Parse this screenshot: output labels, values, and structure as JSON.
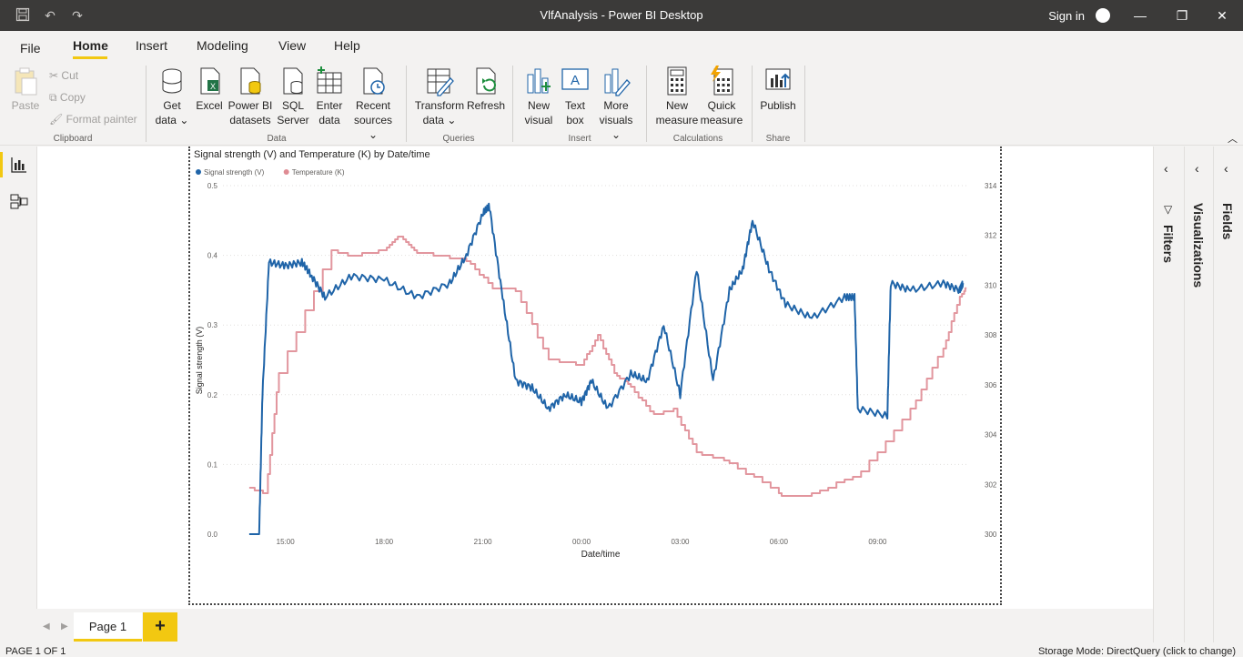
{
  "window": {
    "title": "VlfAnalysis - Power BI Desktop",
    "sign_in": "Sign in",
    "save_icon": "save-icon",
    "undo_icon": "undo-icon",
    "redo_icon": "redo-icon"
  },
  "menu": {
    "items": [
      "File",
      "Home",
      "Insert",
      "Modeling",
      "View",
      "Help"
    ],
    "active": "Home"
  },
  "ribbon": {
    "clipboard": {
      "paste": "Paste",
      "cut": "Cut",
      "copy": "Copy",
      "format_painter": "Format painter",
      "group": "Clipboard"
    },
    "data": {
      "get_data": [
        "Get",
        "data ⌄"
      ],
      "excel": "Excel",
      "power_bi_datasets": [
        "Power BI",
        "datasets"
      ],
      "sql_server": [
        "SQL",
        "Server"
      ],
      "enter_data": [
        "Enter",
        "data"
      ],
      "recent_sources": [
        "Recent",
        "sources ⌄"
      ],
      "group": "Data"
    },
    "queries": {
      "transform_data": [
        "Transform",
        "data ⌄"
      ],
      "refresh": "Refresh",
      "group": "Queries"
    },
    "insert": {
      "new_visual": [
        "New",
        "visual"
      ],
      "text_box": [
        "Text",
        "box"
      ],
      "more_visuals": [
        "More",
        "visuals ⌄"
      ],
      "group": "Insert"
    },
    "calculations": {
      "new_measure": [
        "New",
        "measure"
      ],
      "quick_measure": [
        "Quick",
        "measure"
      ],
      "group": "Calculations"
    },
    "share": {
      "publish": "Publish",
      "group": "Share"
    }
  },
  "panes": {
    "filters": "Filters",
    "visualizations": "Visualizations",
    "fields": "Fields"
  },
  "pages": {
    "tabs": [
      "Page 1"
    ],
    "add": "+"
  },
  "status": {
    "page": "PAGE 1 OF 1",
    "storage": "Storage Mode: DirectQuery (click to change)"
  },
  "chart_data": {
    "type": "line",
    "title": "Signal strength (V) and Temperature (K) by Date/time",
    "xlabel": "Date/time",
    "ylabel": "Signal strength (V)",
    "x_ticks": [
      "15:00",
      "18:00",
      "21:00",
      "00:00",
      "03:00",
      "06:00",
      "09:00"
    ],
    "x_hours": [
      0,
      3,
      6,
      9,
      12,
      15,
      18
    ],
    "xlim_hours": [
      -1.9,
      20.7
    ],
    "ylim": [
      0,
      0.5
    ],
    "y_ticks": [
      "0.0",
      "0.1",
      "0.2",
      "0.3",
      "0.4",
      "0.5"
    ],
    "y2lim": [
      300,
      314
    ],
    "y2_ticks": [
      "300",
      "302",
      "304",
      "306",
      "308",
      "310",
      "312",
      "314"
    ],
    "legend_position": "top-left",
    "series": [
      {
        "name": "Signal strength (V)",
        "axis": "left",
        "color": "#1f64a8",
        "points": [
          [
            -1.1,
            0
          ],
          [
            -0.8,
            0
          ],
          [
            -0.7,
            0.2
          ],
          [
            -0.5,
            0.39
          ],
          [
            0,
            0.385
          ],
          [
            0.5,
            0.39
          ],
          [
            0.8,
            0.37
          ],
          [
            1.2,
            0.34
          ],
          [
            2,
            0.37
          ],
          [
            3,
            0.365
          ],
          [
            4,
            0.34
          ],
          [
            5,
            0.36
          ],
          [
            5.5,
            0.4
          ],
          [
            6,
            0.46
          ],
          [
            6.2,
            0.47
          ],
          [
            6.6,
            0.34
          ],
          [
            7,
            0.22
          ],
          [
            7.5,
            0.21
          ],
          [
            8,
            0.18
          ],
          [
            8.5,
            0.2
          ],
          [
            9,
            0.19
          ],
          [
            9.3,
            0.22
          ],
          [
            9.8,
            0.18
          ],
          [
            10.5,
            0.23
          ],
          [
            11,
            0.22
          ],
          [
            11.5,
            0.3
          ],
          [
            12,
            0.2
          ],
          [
            12.5,
            0.38
          ],
          [
            13,
            0.22
          ],
          [
            13.5,
            0.35
          ],
          [
            13.9,
            0.38
          ],
          [
            14.2,
            0.45
          ],
          [
            14.7,
            0.38
          ],
          [
            15.2,
            0.33
          ],
          [
            16,
            0.31
          ],
          [
            17,
            0.34
          ],
          [
            17.3,
            0.34
          ],
          [
            17.4,
            0.18
          ],
          [
            18.3,
            0.17
          ],
          [
            18.4,
            0.36
          ],
          [
            19,
            0.35
          ],
          [
            20,
            0.36
          ],
          [
            20.5,
            0.35
          ],
          [
            20.6,
            0.36
          ]
        ]
      },
      {
        "name": "Temperature (K)",
        "axis": "right",
        "color": "#df8b93",
        "points": [
          [
            -1.1,
            301.9
          ],
          [
            -0.6,
            301.6
          ],
          [
            -0.2,
            306.5
          ],
          [
            1.4,
            311.4
          ],
          [
            2,
            311.2
          ],
          [
            3,
            311.4
          ],
          [
            3.5,
            312
          ],
          [
            4,
            311.3
          ],
          [
            5.5,
            311
          ],
          [
            6.3,
            309.9
          ],
          [
            7,
            309.8
          ],
          [
            8,
            307
          ],
          [
            9,
            306.8
          ],
          [
            9.5,
            308
          ],
          [
            10,
            306.5
          ],
          [
            10.5,
            305.9
          ],
          [
            11.2,
            304.8
          ],
          [
            11.8,
            305
          ],
          [
            12.5,
            303.3
          ],
          [
            13.5,
            302.9
          ],
          [
            15,
            301.6
          ],
          [
            15.5,
            301.5
          ],
          [
            16,
            301.6
          ],
          [
            17.5,
            302.5
          ],
          [
            19,
            305
          ],
          [
            20,
            307.5
          ],
          [
            20.5,
            309.5
          ],
          [
            20.7,
            309.9
          ]
        ]
      }
    ]
  }
}
